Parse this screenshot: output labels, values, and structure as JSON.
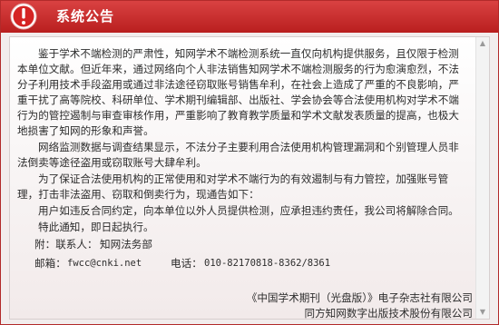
{
  "window": {
    "title": "系统公告",
    "icon": "alert-exclamation-icon",
    "accent_color": "#c92b2b"
  },
  "notice": {
    "paragraphs": [
      "鉴于学术不端检测的严肃性，知网学术不端检测系统一直仅向机构提供服务，且仅限于检测本单位文献。但近年来，通过网络向个人非法销售知网学术不端检测服务的行为愈演愈烈，不法分子利用技术手段盗用或通过非法途径窃取账号销售牟利，在社会上造成了严重的不良影响，严重干扰了高等院校、科研单位、学术期刊编辑部、出版社、学会协会等合法使用机构对学术不端行为的管控遏制与审查审核作用，严重影响了教育教学质量和学术文献发表质量的提高，也极大地损害了知网的形象和声誉。",
      "网络监测数据与调查结果显示，不法分子主要利用合法使用机构管理漏洞和个别管理人员非法倒卖等途径盗用或窃取账号大肆牟利。",
      "为了保证合法使用机构的正常使用和对学术不端行为的有效遏制与有力管控，加强账号管理，打击非法盗用、窃取和倒卖行为，现通告如下：",
      "用户如违反合同约定，向本单位以外人员提供检测，应承担违约责任，我公司将解除合同。",
      "特此通知，即日起执行。"
    ]
  },
  "contact": {
    "contact_label": "附：联系人：",
    "contact_value": "知网法务部",
    "email_label": "邮箱：",
    "email_value": "fwcc@cnki.net",
    "phone_label": "电话：",
    "phone_value": "010-82170818-8362/8361"
  },
  "signature": {
    "line1": "《中国学术期刊（光盘版）》电子杂志社有限公司",
    "line2": "同方知网数字出版技术股份有限公司"
  }
}
